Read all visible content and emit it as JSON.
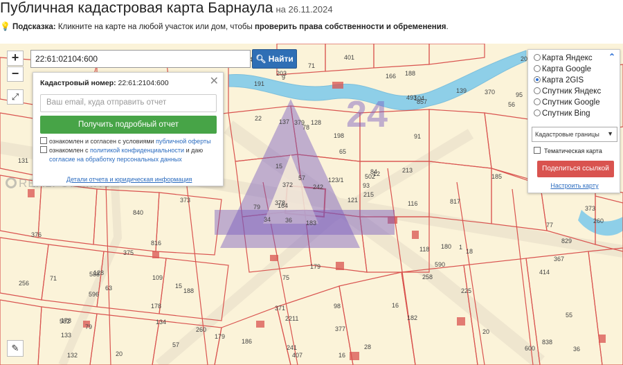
{
  "header": {
    "title": "Публичная кадастровая карта Барнаула",
    "date": "на 26.11.2024"
  },
  "hint": {
    "label": "Подсказка:",
    "text": " Кликните на карте на любой участок или дом, чтобы ",
    "bold": "проверить права собственности и обременения",
    "end": "."
  },
  "search": {
    "value": "22:61:02104:600",
    "button_label": "Найти"
  },
  "zoom": {
    "in_label": "+",
    "out_label": "−"
  },
  "popup": {
    "cad_label": "Кадастровый номер:",
    "cad_value": "22:61:2104:600",
    "email_placeholder": "Ваш email, куда отправить отчет",
    "report_button": "Получить подробный отчет",
    "check1_text": "ознакомлен и согласен с условиями ",
    "check1_link": "публичной оферты",
    "check2_text": "ознакомлен с ",
    "check2_link1": "политикой конфиденциальности",
    "check2_mid": " и даю",
    "check2_link2": "согласие на обработку персональных данных",
    "details_link": "Детали отчета и юридическая информация"
  },
  "layers": {
    "options": [
      "Карта Яндекс",
      "Карта Google",
      "Карта 2GIS",
      "Спутник Яндекс",
      "Спутник Google",
      "Спутник Bing"
    ],
    "selected": "Карта 2GIS",
    "select_value": "Кадастровые границы",
    "thematic_label": "Тематическая карта",
    "share_button": "Поделиться ссылкой",
    "configure_link": "Настроить карту"
  },
  "watermark": {
    "brand": "24",
    "text": "REALFORM.RU"
  },
  "map_labels": [
    "183",
    "164",
    "178",
    "502",
    "188",
    "188",
    "128",
    "104",
    "121",
    "36",
    "34",
    "91",
    "20",
    "137",
    "65",
    "63",
    "133",
    "134",
    "379",
    "12",
    "18",
    "9",
    "118",
    "378",
    "371",
    "372",
    "139",
    "15",
    "600",
    "55",
    "1",
    "401",
    "258",
    "57",
    "131",
    "93",
    "132",
    "2211",
    "215",
    "596",
    "590",
    "182",
    "178",
    "98",
    "95",
    "71",
    "373",
    "370",
    "166",
    "191",
    "57",
    "256",
    "75",
    "179",
    "180",
    "582",
    "376",
    "15",
    "377",
    "123/1",
    "79",
    "116",
    "367",
    "241",
    "179",
    "20",
    "16",
    "16",
    "203",
    "260",
    "213",
    "225",
    "242",
    "414",
    "407",
    "493",
    "857",
    "840",
    "373",
    "375",
    "109",
    "260",
    "84",
    "56",
    "77",
    "78",
    "79",
    "71",
    "36",
    "22",
    "24",
    "588",
    "206",
    "198",
    "817",
    "816",
    "838",
    "186",
    "185",
    "128",
    "28",
    "829"
  ],
  "colors": {
    "map_bg": "#fbf3d9",
    "parcel": "#d9534f",
    "water": "#8ecfe8",
    "road": "#e9e2cf",
    "search_btn": "#2f6fb5",
    "report_btn": "#47a447",
    "share_btn": "#d9534f"
  }
}
